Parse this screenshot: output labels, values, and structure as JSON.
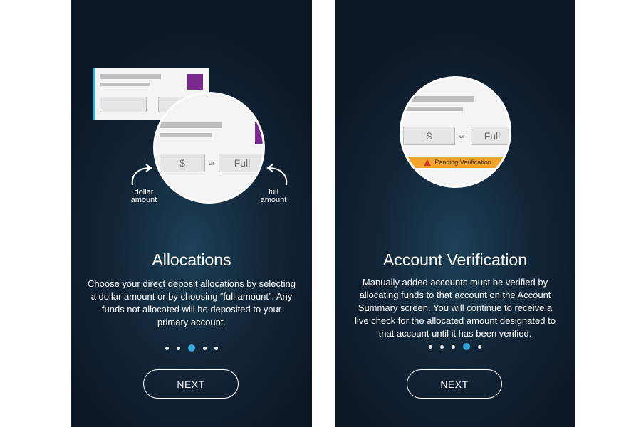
{
  "screens": [
    {
      "title": "Allocations",
      "body": "Choose your direct deposit allocations by selecting a dollar amount or by choosing “full amount”.  Any funds not allocated will be deposited to your primary account.",
      "illustration": {
        "dollar_box": "$",
        "or_text": "or",
        "full_box": "Full",
        "left_label_line1": "dollar",
        "left_label_line2": "amount",
        "right_label_line1": "full",
        "right_label_line2": "amount"
      },
      "pagination": {
        "total": 5,
        "active_index": 3
      },
      "next_label": "NEXT"
    },
    {
      "title": "Account Verification",
      "body": "Manually added accounts must be verified by allocating funds to that account on the Account Summary screen. You will continue to receive a live check for the allocated amount designated to that account until it has been verified.",
      "illustration": {
        "dollar_box": "$",
        "or_text": "or",
        "full_box": "Full",
        "pending_text": "Pending Verification",
        "pending_icon": "warning-icon"
      },
      "pagination": {
        "total": 5,
        "active_index": 4
      },
      "next_label": "NEXT"
    }
  ],
  "colors": {
    "background_dark": "#0b1622",
    "accent_dot": "#38a8dd",
    "purple_accent": "#7a2a8e",
    "pending_bar": "#f2a52a"
  }
}
